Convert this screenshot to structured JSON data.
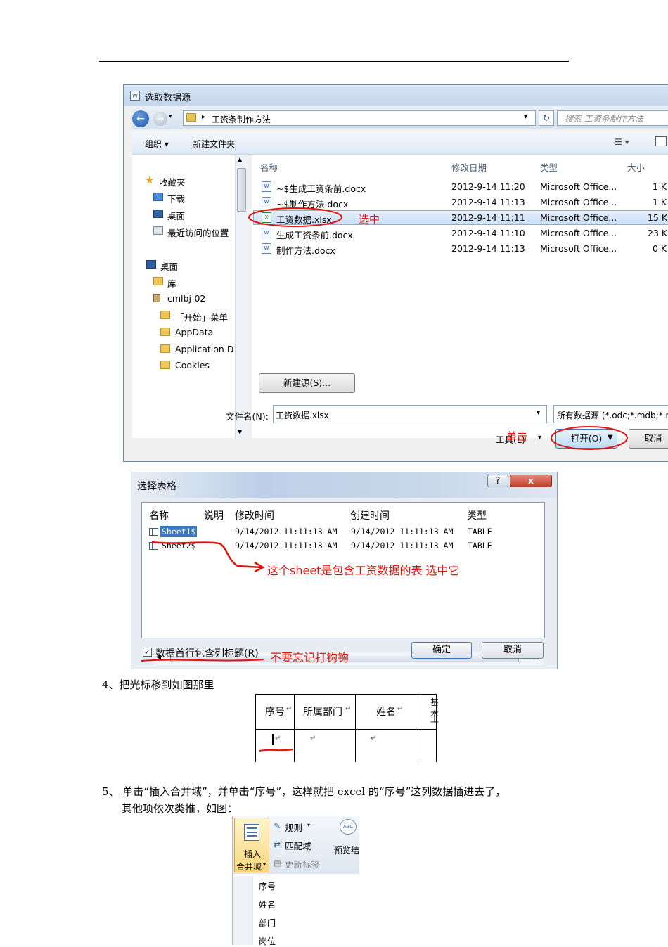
{
  "dialog1": {
    "title": "选取数据源",
    "path_sep": "▸",
    "path": "工资条制作方法",
    "search_placeholder": "搜索 工资条制作方法",
    "toolbar": {
      "organize": "组织 ▾",
      "new_folder": "新建文件夹"
    },
    "nav": {
      "favorites": "收藏夹",
      "downloads": "下载",
      "desktop_fav": "桌面",
      "recent": "最近访问的位置",
      "desktop": "桌面",
      "libraries": "库",
      "user": "cmlbj-02",
      "start_menu": "「开始」菜单",
      "appdata": "AppData",
      "application_data": "Application D",
      "cookies": "Cookies"
    },
    "columns": {
      "name": "名称",
      "date": "修改日期",
      "type": "类型",
      "size": "大小"
    },
    "files": [
      {
        "name": "~$生成工资条前.docx",
        "date": "2012-9-14 11:20",
        "type": "Microsoft Office...",
        "size": "1 K"
      },
      {
        "name": "~$制作方法.docx",
        "date": "2012-9-14 11:13",
        "type": "Microsoft Office...",
        "size": "1 K"
      },
      {
        "name": "工资数据.xlsx",
        "date": "2012-9-14 11:11",
        "type": "Microsoft Office...",
        "size": "15 K"
      },
      {
        "name": "生成工资条前.docx",
        "date": "2012-9-14 11:10",
        "type": "Microsoft Office...",
        "size": "23 K"
      },
      {
        "name": "制作方法.docx",
        "date": "2012-9-14 11:13",
        "type": "Microsoft Office...",
        "size": "0 K"
      }
    ],
    "new_source_btn": "新建源(S)...",
    "filename_label": "文件名(N):",
    "filename_value": "工资数据.xlsx",
    "filetype_value": "所有数据源 (*.odc;*.mdb;*.m",
    "tools_label": "工具(L)",
    "open_btn": "打开(O)",
    "cancel_btn": "取消",
    "note_select": "选中",
    "note_click": "单击"
  },
  "dialog2": {
    "title": "选择表格",
    "help": "?",
    "close": "x",
    "columns": {
      "name": "名称",
      "desc": "说明",
      "modified": "修改时间",
      "created": "创建时间",
      "type": "类型"
    },
    "rows": [
      {
        "name": "Sheet1$",
        "modified": "9/14/2012 11:11:13 AM",
        "created": "9/14/2012 11:11:13 AM",
        "type": "TABLE"
      },
      {
        "name": "Sheet2$",
        "modified": "9/14/2012 11:11:13 AM",
        "created": "9/14/2012 11:11:13 AM",
        "type": "TABLE"
      }
    ],
    "note_sheet": "这个sheet是包含工资数据的表  选中它",
    "checkbox_label": "数据首行包含列标题(R)",
    "note_check": "不要忘记打钩钩",
    "ok_btn": "确定",
    "cancel_btn": "取消"
  },
  "step4": "4、把光标移到如图那里",
  "word_table": {
    "headers": [
      "序号",
      "所属部门",
      "姓名",
      "基本",
      "工"
    ]
  },
  "step5_line1": "5、 单击“插入合并域”，并单击“序号”，这样就把 excel 的“序号”这列数据插进去了，",
  "step5_line2": "其他项依次类推，如图：",
  "ribbon": {
    "insert_field_line1": "插入",
    "insert_field_line2": "合并域",
    "rules": "规则",
    "match_fields": "匹配域",
    "update_labels": "更新标签",
    "preview": "预览结",
    "menu": [
      "序号",
      "姓名",
      "部门",
      "岗位"
    ]
  }
}
